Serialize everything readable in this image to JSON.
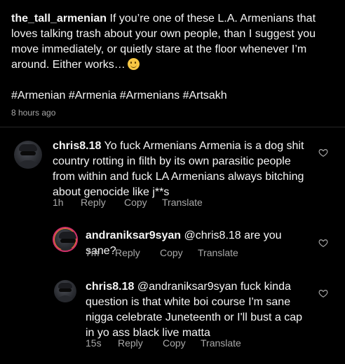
{
  "post": {
    "username": "the_tall_armenian",
    "caption": "If you’re one of these L.A. Armenians that loves talking trash about your own people, than I suggest you move immediately, or quietly stare at the floor whenever I’m around. Either works…",
    "emoji": "slightly-smiling-face",
    "hashtags": "#Armenian #Armenia #Armenians #Artsakh",
    "time_ago": "8 hours ago"
  },
  "comments": [
    {
      "username": "chris8.18",
      "text": "Yo fuck Armenians Armenia is a dog shit country rotting in filth by its own parasitic people from within and fuck LA Armenians always bitching about genocide like j**s",
      "time": "1h",
      "reply": "Reply",
      "copy": "Copy",
      "translate": "Translate"
    },
    {
      "username": "andraniksar9syan",
      "text": "@chris8.18 are you sane?",
      "time": "7m",
      "reply": "Reply",
      "copy": "Copy",
      "translate": "Translate"
    },
    {
      "username": "chris8.18",
      "text": "@andraniksar9syan fuck kinda question is that white boi course I'm sane nigga celebrate Juneteenth or I'll bust a cap in yo ass black live matta",
      "time": "15s",
      "reply": "Reply",
      "copy": "Copy",
      "translate": "Translate"
    }
  ],
  "icons": {
    "like": "heart-outline-icon"
  },
  "colors": {
    "background": "#000000",
    "text": "#f5f5f5",
    "muted": "#a8a8a8"
  }
}
